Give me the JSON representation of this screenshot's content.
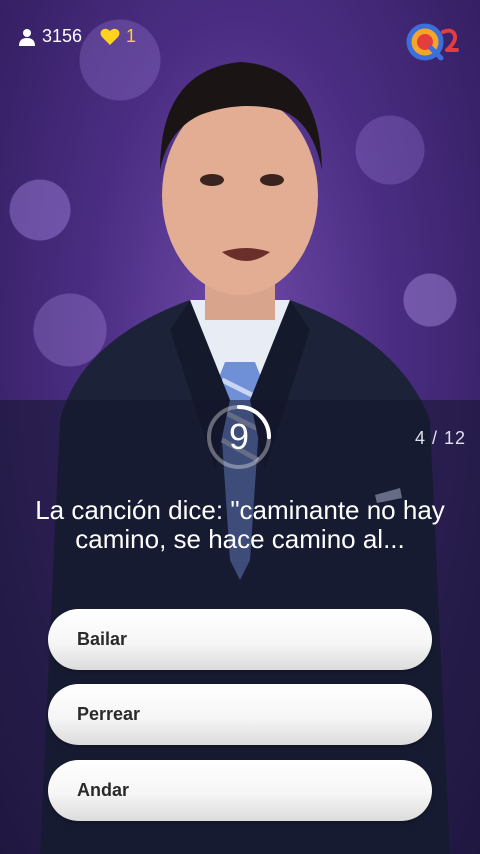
{
  "topbar": {
    "players_count": "3156",
    "lives_count": "1",
    "logo_icon": "q12-logo-icon",
    "players_icon": "person-icon",
    "lives_icon": "heart-icon",
    "lives_color": "#ffd21f"
  },
  "quiz": {
    "timer_value": "9",
    "timer_fraction_remaining": 0.25,
    "progress": "4 / 12",
    "question": "La canción dice: \"caminante no hay camino, se hace camino al...",
    "answers": [
      {
        "label": "Bailar"
      },
      {
        "label": "Perrear"
      },
      {
        "label": "Andar"
      }
    ]
  }
}
